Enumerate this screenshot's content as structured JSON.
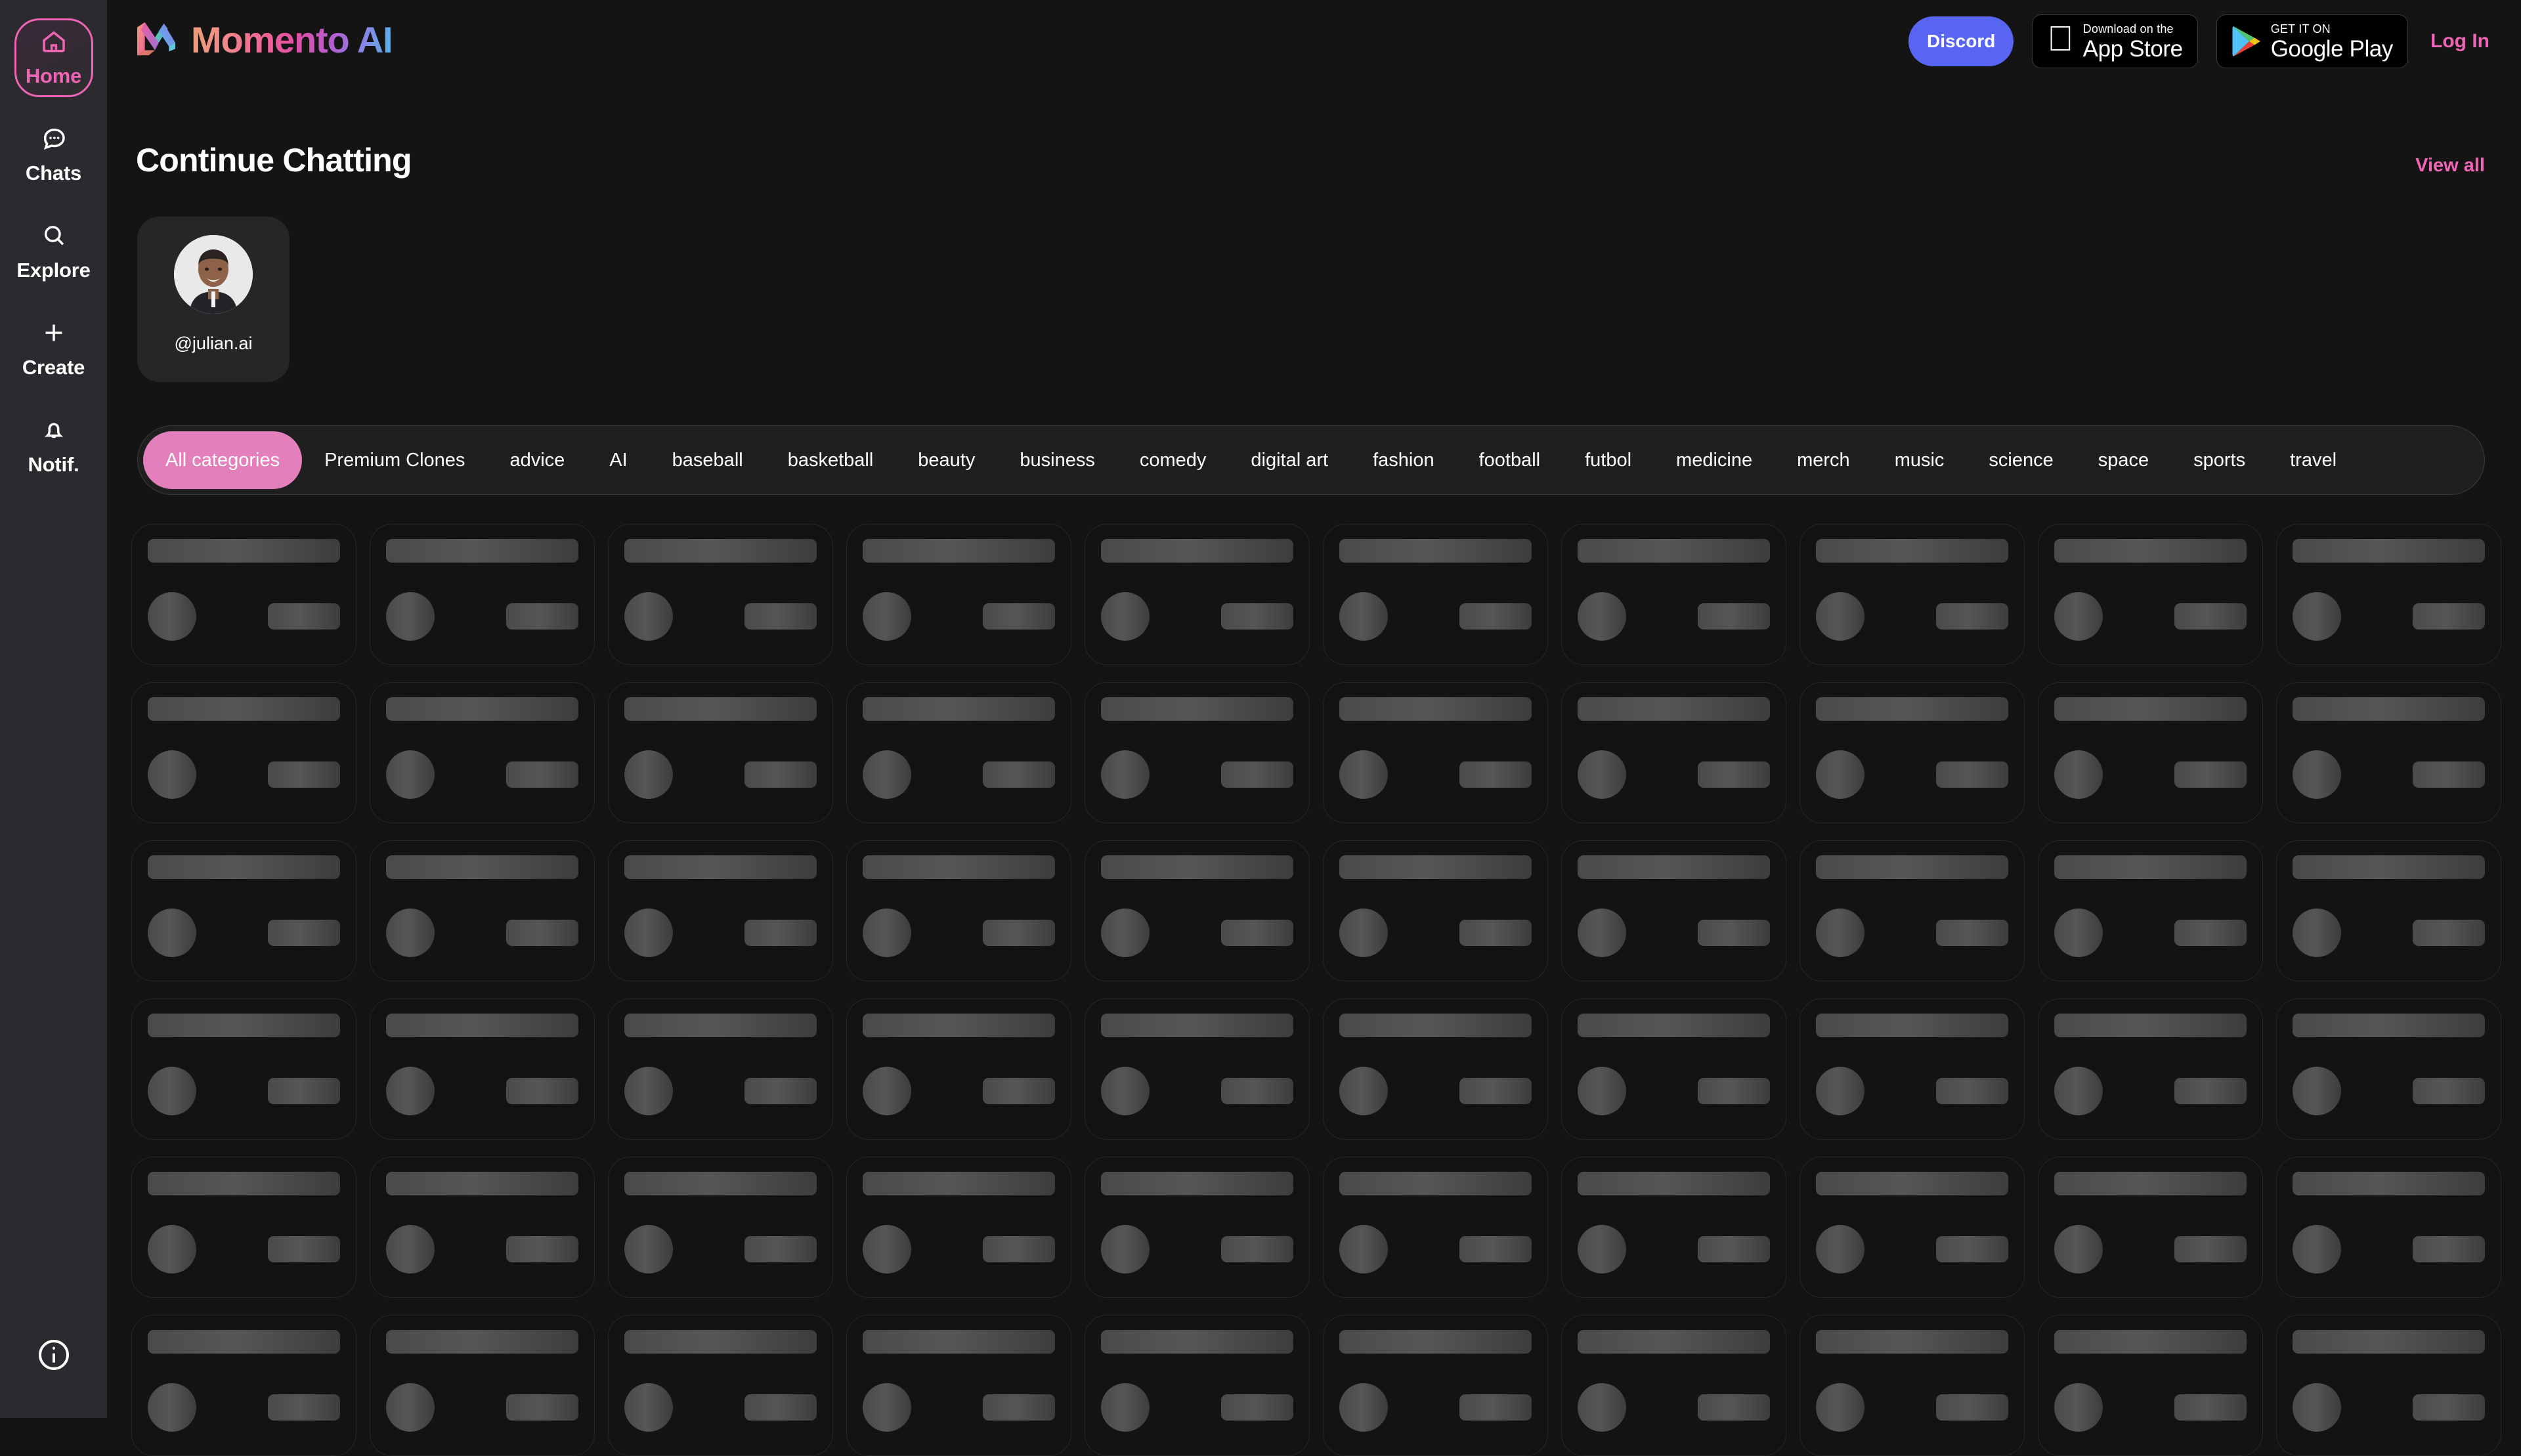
{
  "sidebar": {
    "items": [
      {
        "label": "Home",
        "icon": "home-icon",
        "active": true
      },
      {
        "label": "Chats",
        "icon": "chat-icon",
        "active": false
      },
      {
        "label": "Explore",
        "icon": "search-icon",
        "active": false
      },
      {
        "label": "Create",
        "icon": "plus-icon",
        "active": false
      },
      {
        "label": "Notif.",
        "icon": "bell-icon",
        "active": false
      }
    ],
    "info_icon": "info-icon"
  },
  "header": {
    "logo_text": "Momento AI",
    "logo_mark": "momento-m-logo",
    "discord_label": "Discord",
    "app_store": {
      "small": "Download on the",
      "big": "App Store",
      "icon": "apple-icon"
    },
    "google_play": {
      "small": "GET IT ON",
      "big": "Google Play",
      "icon": "google-play-icon"
    },
    "login_label": "Log In"
  },
  "continue_chatting": {
    "title": "Continue Chatting",
    "view_all_label": "View all",
    "cards": [
      {
        "handle": "@julian.ai",
        "avatar": "user-avatar-photo"
      }
    ]
  },
  "categories": {
    "selected": "All categories",
    "items": [
      "All categories",
      "Premium Clones",
      "advice",
      "AI",
      "baseball",
      "basketball",
      "beauty",
      "business",
      "comedy",
      "digital art",
      "fashion",
      "football",
      "futbol",
      "medicine",
      "merch",
      "music",
      "science",
      "space",
      "sports",
      "travel"
    ]
  },
  "grid": {
    "columns": 10,
    "rows": 6,
    "loading": true,
    "placeholder_count": 60
  },
  "colors": {
    "background": "#141414",
    "sidebar": "#2b2a2f",
    "accent_pink": "#ef64b4",
    "pill_pink": "#e37fbb",
    "discord_blurple": "#5865f2",
    "card": "#262626",
    "skeleton": "#4a4a4a"
  }
}
